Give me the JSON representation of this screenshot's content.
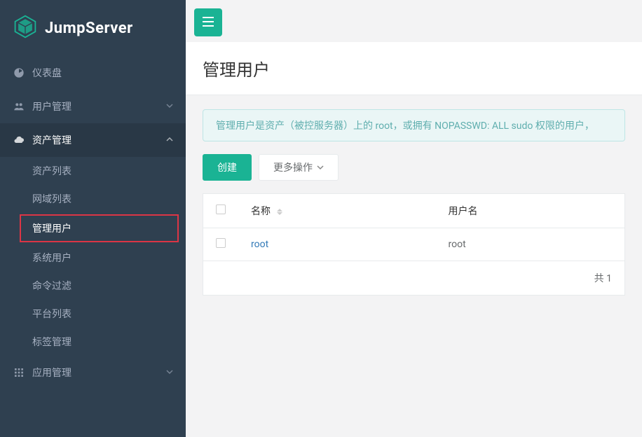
{
  "brand": "JumpServer",
  "sidebar": {
    "dashboard": "仪表盘",
    "user_mgmt": "用户管理",
    "asset_mgmt": "资产管理",
    "asset_sub": {
      "asset_list": "资产列表",
      "domain_list": "网域列表",
      "admin_user": "管理用户",
      "system_user": "系统用户",
      "cmd_filter": "命令过滤",
      "platform_list": "平台列表",
      "label_mgmt": "标签管理"
    },
    "app_mgmt": "应用管理"
  },
  "page": {
    "title": "管理用户",
    "info": "管理用户是资产（被控服务器）上的 root，或拥有 NOPASSWD: ALL sudo 权限的用户，"
  },
  "actions": {
    "create": "创建",
    "more": "更多操作"
  },
  "table": {
    "headers": {
      "name": "名称",
      "username": "用户名"
    },
    "rows": [
      {
        "name": "root",
        "username": "root"
      }
    ],
    "footer": "共 1"
  }
}
